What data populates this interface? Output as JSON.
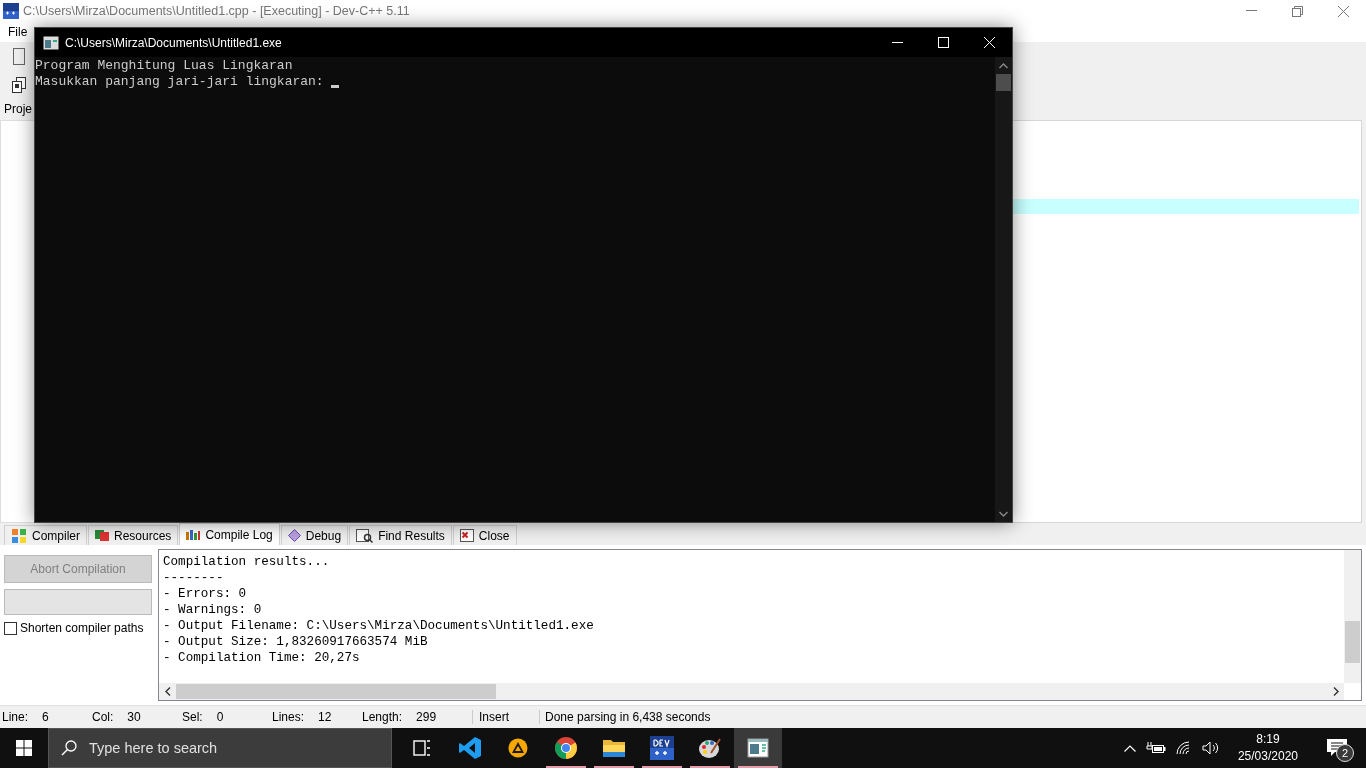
{
  "ide_window": {
    "title": "C:\\Users\\Mirza\\Documents\\Untitled1.cpp - [Executing] - Dev-C++ 5.11",
    "menu": [
      "File"
    ],
    "project_panel": {
      "tab": "Proje"
    },
    "bottom_tabs": [
      {
        "label": "Compiler",
        "selected": false
      },
      {
        "label": "Resources",
        "selected": false
      },
      {
        "label": "Compile Log",
        "selected": true
      },
      {
        "label": "Debug",
        "selected": false
      },
      {
        "label": "Find Results",
        "selected": false
      },
      {
        "label": "Close",
        "selected": false
      }
    ],
    "compiler_panel": {
      "abort_button": {
        "label": "Abort Compilation",
        "disabled": true
      },
      "shorten_paths": {
        "label": "Shorten compiler paths",
        "checked": false
      },
      "log_lines": [
        "Compilation results...",
        "--------",
        "- Errors: 0",
        "- Warnings: 0",
        "- Output Filename: C:\\Users\\Mirza\\Documents\\Untitled1.exe",
        "- Output Size: 1,83260917663574 MiB",
        "- Compilation Time: 20,27s"
      ]
    },
    "status_bar": [
      {
        "label": "Line:",
        "value": "6"
      },
      {
        "label": "Col:",
        "value": "30"
      },
      {
        "label": "Sel:",
        "value": "0"
      },
      {
        "label": "Lines:",
        "value": "12"
      },
      {
        "label": "Length:",
        "value": "299"
      }
    ],
    "mode": "Insert",
    "message": "Done parsing in 6,438 seconds"
  },
  "console_window": {
    "title": "C:\\Users\\Mirza\\Documents\\Untitled1.exe",
    "lines": [
      "Program Menghitung Luas Lingkaran",
      "Masukkan panjang jari-jari lingkaran: "
    ]
  },
  "taskbar": {
    "search_placeholder": "Type here to search",
    "apps": [
      {
        "kind": "taskview",
        "running": false,
        "active": false
      },
      {
        "kind": "vscode",
        "running": false,
        "active": false
      },
      {
        "kind": "warning",
        "running": false,
        "active": false
      },
      {
        "kind": "chrome",
        "running": true,
        "active": false
      },
      {
        "kind": "folder",
        "running": true,
        "active": false
      },
      {
        "kind": "devcpp",
        "running": true,
        "active": false
      },
      {
        "kind": "paint",
        "running": true,
        "active": false
      },
      {
        "kind": "console",
        "running": true,
        "active": true
      }
    ],
    "time": "8:19",
    "date": "25/03/2020",
    "notifications": "2"
  }
}
